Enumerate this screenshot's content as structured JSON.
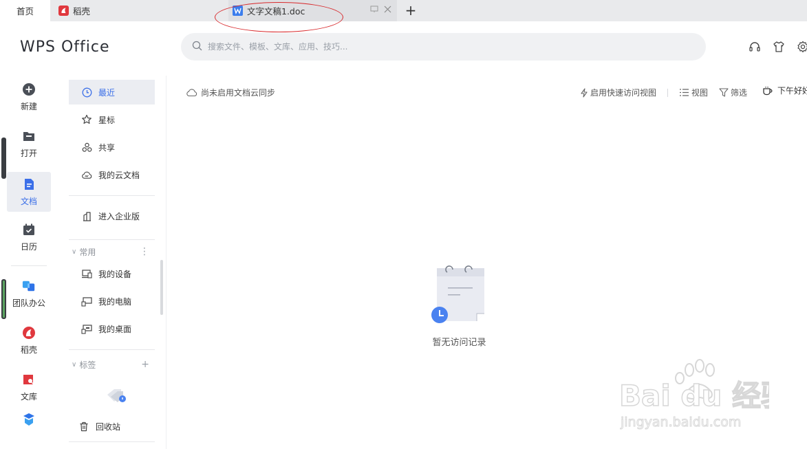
{
  "tabs": {
    "home": "首页",
    "daoke": "稻壳",
    "document": "文字文稿1.doc",
    "new_tab": "+"
  },
  "header": {
    "logo": "WPS Office",
    "search_placeholder": "搜索文件、模板、文库、应用、技巧..."
  },
  "rail": {
    "items": [
      {
        "label": "新建",
        "icon": "plus-circle-icon"
      },
      {
        "label": "打开",
        "icon": "folder-icon"
      },
      {
        "label": "文档",
        "icon": "document-icon"
      },
      {
        "label": "日历",
        "icon": "calendar-icon"
      },
      {
        "label": "团队办公",
        "icon": "team-icon"
      },
      {
        "label": "稻壳",
        "icon": "daoke-icon"
      },
      {
        "label": "文库",
        "icon": "library-icon"
      }
    ],
    "active_index": 2
  },
  "nav": {
    "recent": "最近",
    "starred": "星标",
    "shared": "共享",
    "cloud_docs": "我的云文档",
    "enterprise": "进入企业版",
    "common_group": "常用",
    "my_device": "我的设备",
    "my_computer": "我的电脑",
    "my_desktop": "我的桌面",
    "tags_group": "标签",
    "recycle_bin": "回收站"
  },
  "content": {
    "sync_notice": "尚未启用文档云同步",
    "quick_access": "启用快速访问视图",
    "view": "视图",
    "filter": "筛选",
    "greeting": "下午好好",
    "empty_text": "暂无访问记录"
  },
  "watermark": {
    "brand": "Bai du 经验",
    "url": "jingyan.baidu.com"
  },
  "colors": {
    "accent": "#3b6fe8",
    "annotation": "#d8282b",
    "daoke_red": "#e0383e"
  }
}
